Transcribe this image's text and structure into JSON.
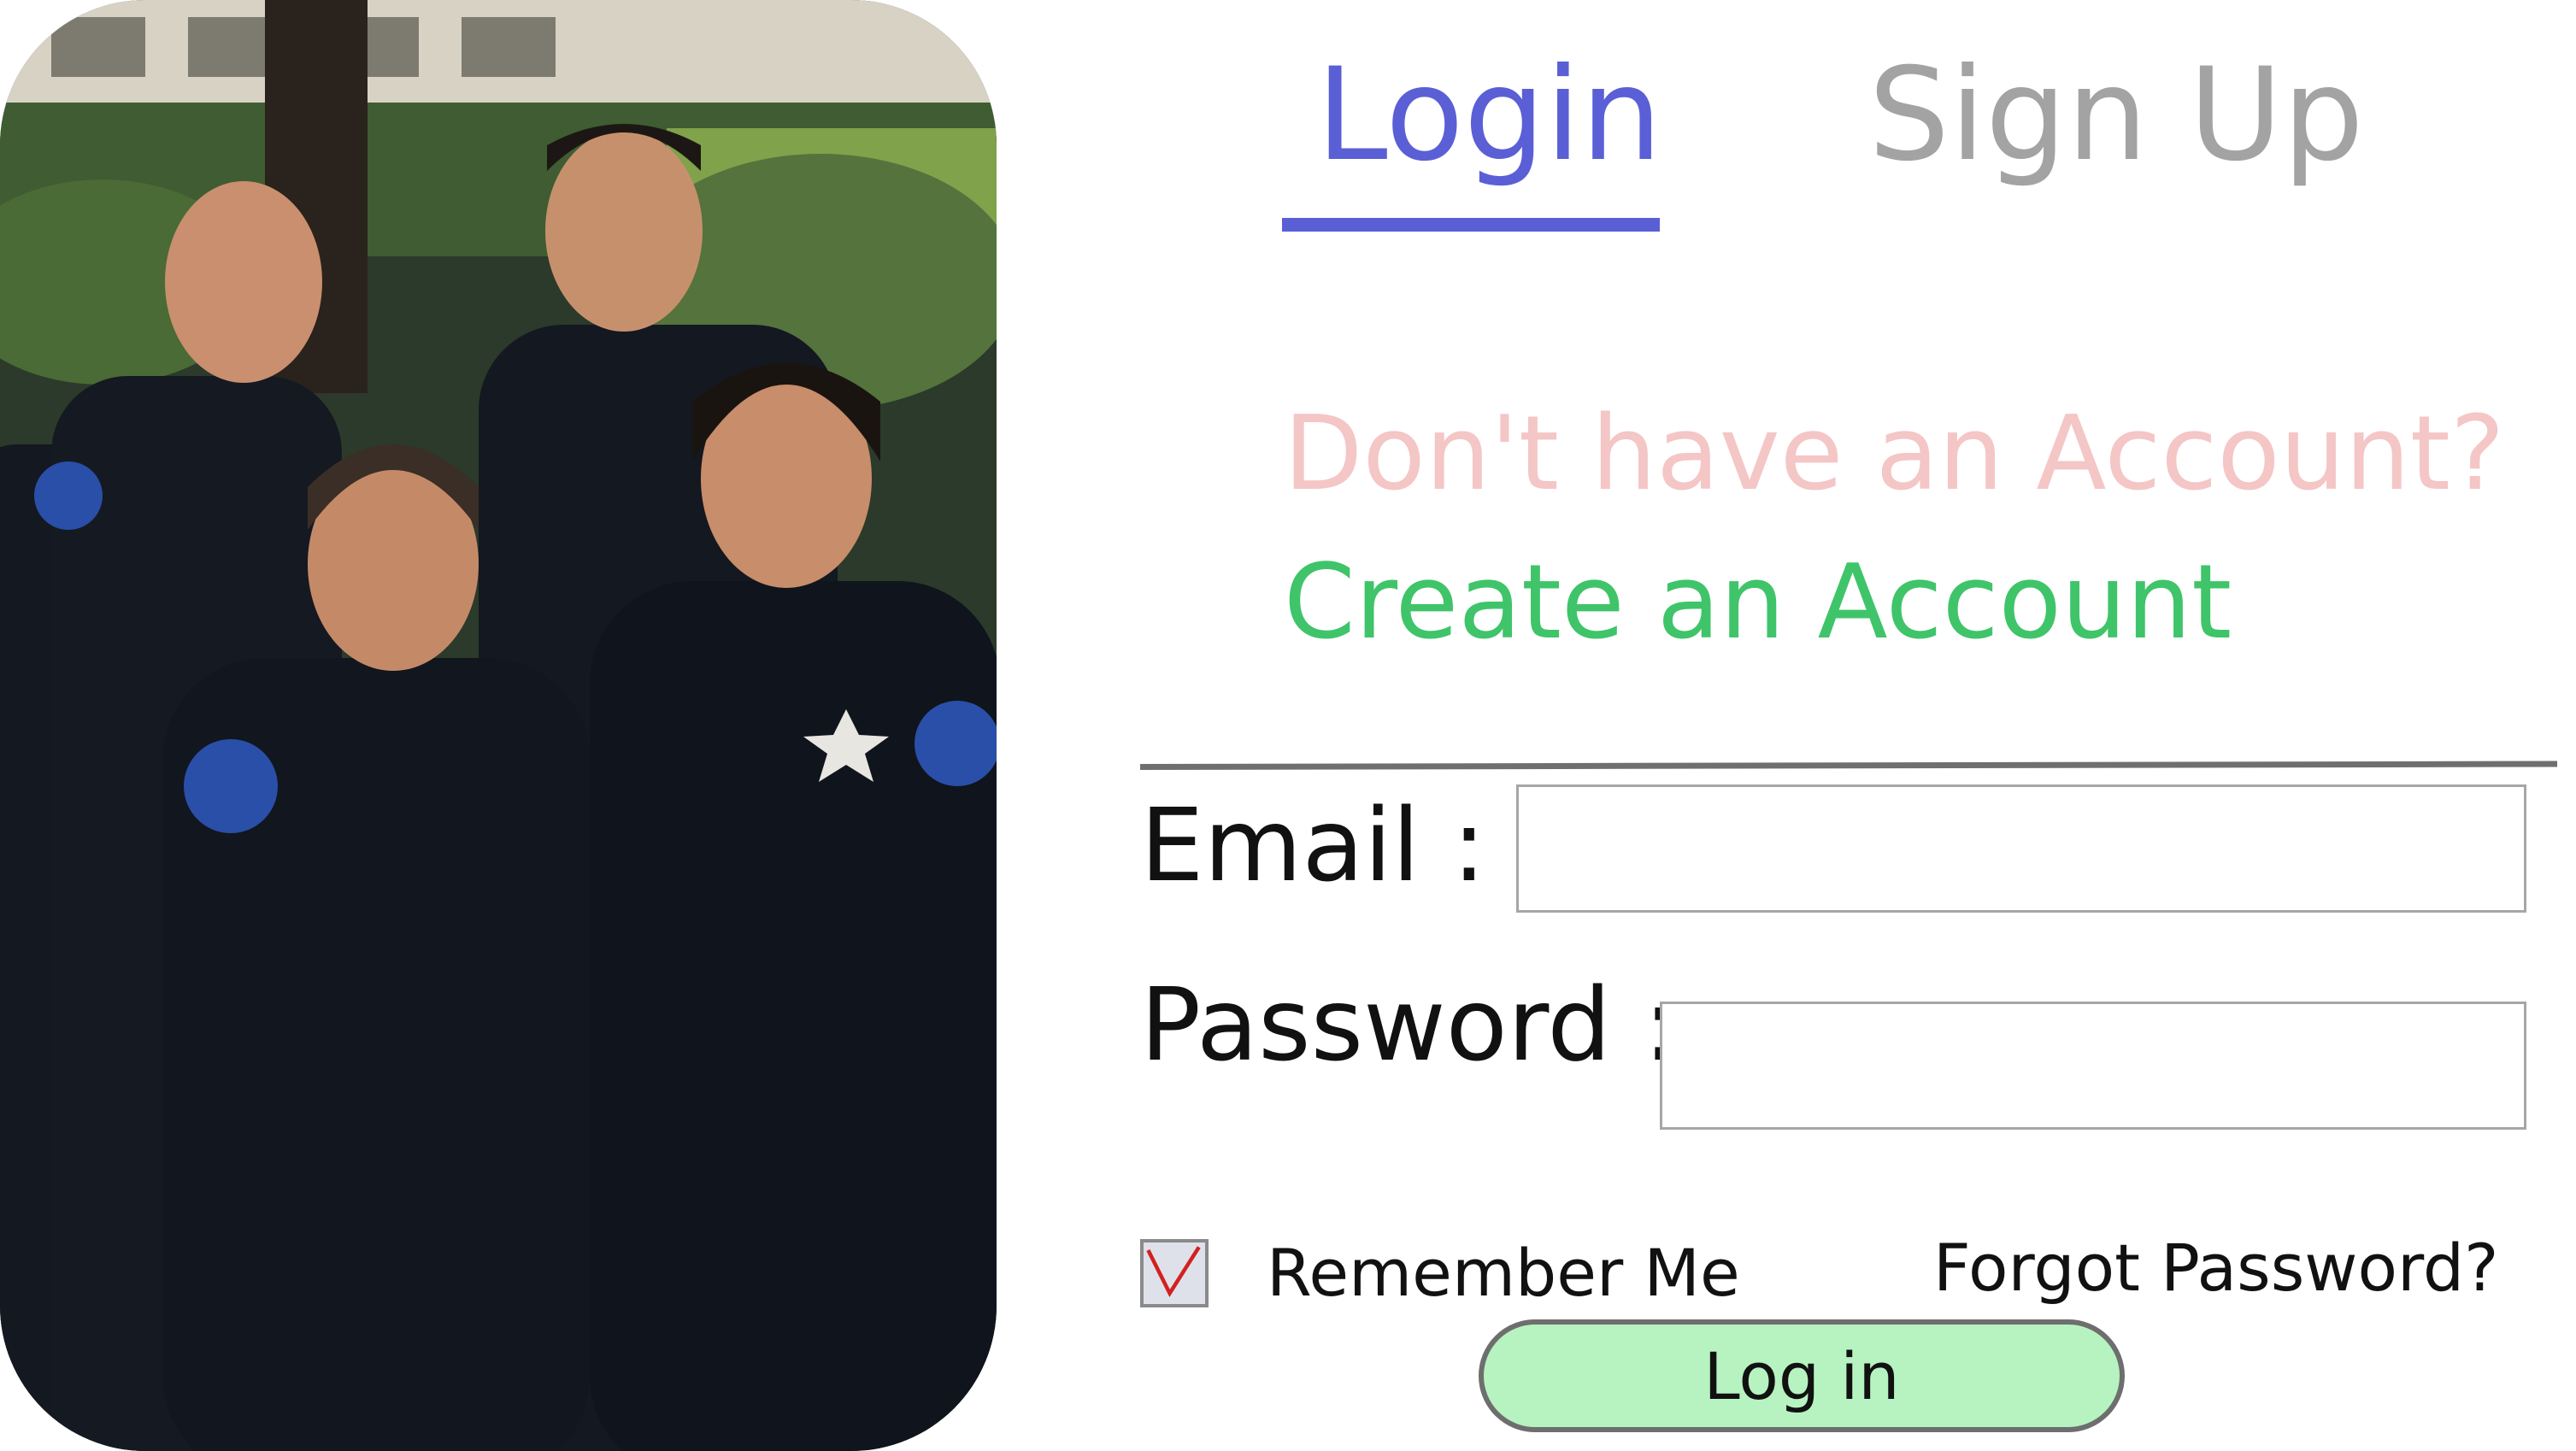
{
  "photo": {
    "alt": "Police officers group photo",
    "colors": {
      "uniform": "#141821",
      "skin": "#c98f6e",
      "foliage": "#3f5c32",
      "lawn": "#7fa24b",
      "building": "#d8d2c4"
    }
  },
  "tabs": [
    {
      "label": "Login",
      "active": true
    },
    {
      "label": "Sign Up",
      "active": false
    }
  ],
  "prompt": {
    "question": "Don't have an Account?",
    "link": "Create an Account"
  },
  "form": {
    "email_label": "Email :",
    "email_value": "",
    "password_label": "Password :",
    "password_value": "",
    "remember_label": "Remember Me",
    "remember_checked": true,
    "forgot_label": "Forgot Password?",
    "submit_label": "Log in"
  },
  "colors": {
    "active_tab": "#5a5fd6",
    "inactive_tab": "#a3a3a3",
    "prompt": "#f4c6c6",
    "link": "#3fc46a",
    "checkmark": "#d32020",
    "button_fill": "#b6f3c0"
  }
}
